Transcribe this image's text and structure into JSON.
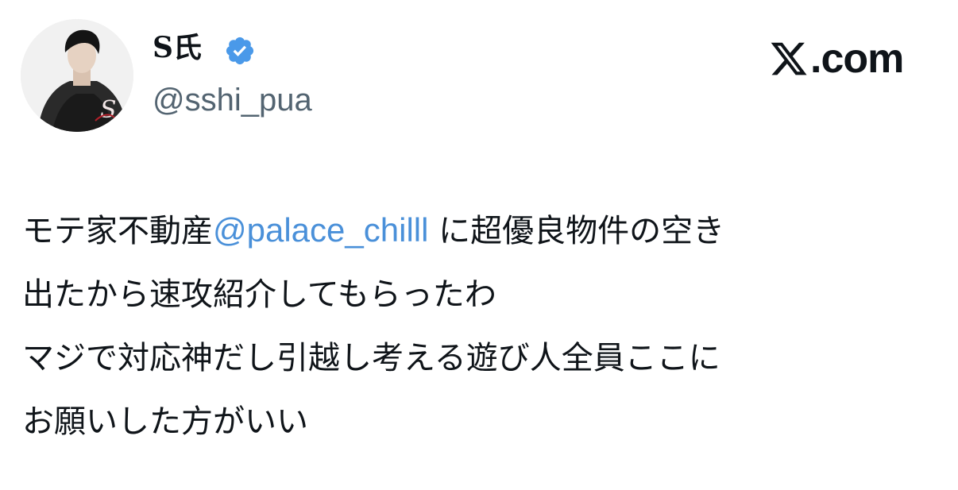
{
  "post": {
    "author": {
      "display_name": "S氏",
      "handle": "@sshi_pua",
      "verified": true,
      "verified_color": "#4a99e9",
      "avatar_icon": "avatar-portrait"
    },
    "brand": {
      "logo_icon": "x-logo-icon",
      "logo_text": ".com"
    },
    "text": {
      "line1_before": "モテ家不動産",
      "line1_mention": "@palace_chilll",
      "line1_after": " に超優良物件の空き",
      "line2": "出たから速攻紹介してもらったわ",
      "line3": "マジで対応神だし引越し考える遊び人全員ここに",
      "line4": "お願いした方がいい"
    },
    "colors": {
      "text": "#0f1419",
      "handle": "#536471",
      "mention": "#4a90d9"
    }
  }
}
